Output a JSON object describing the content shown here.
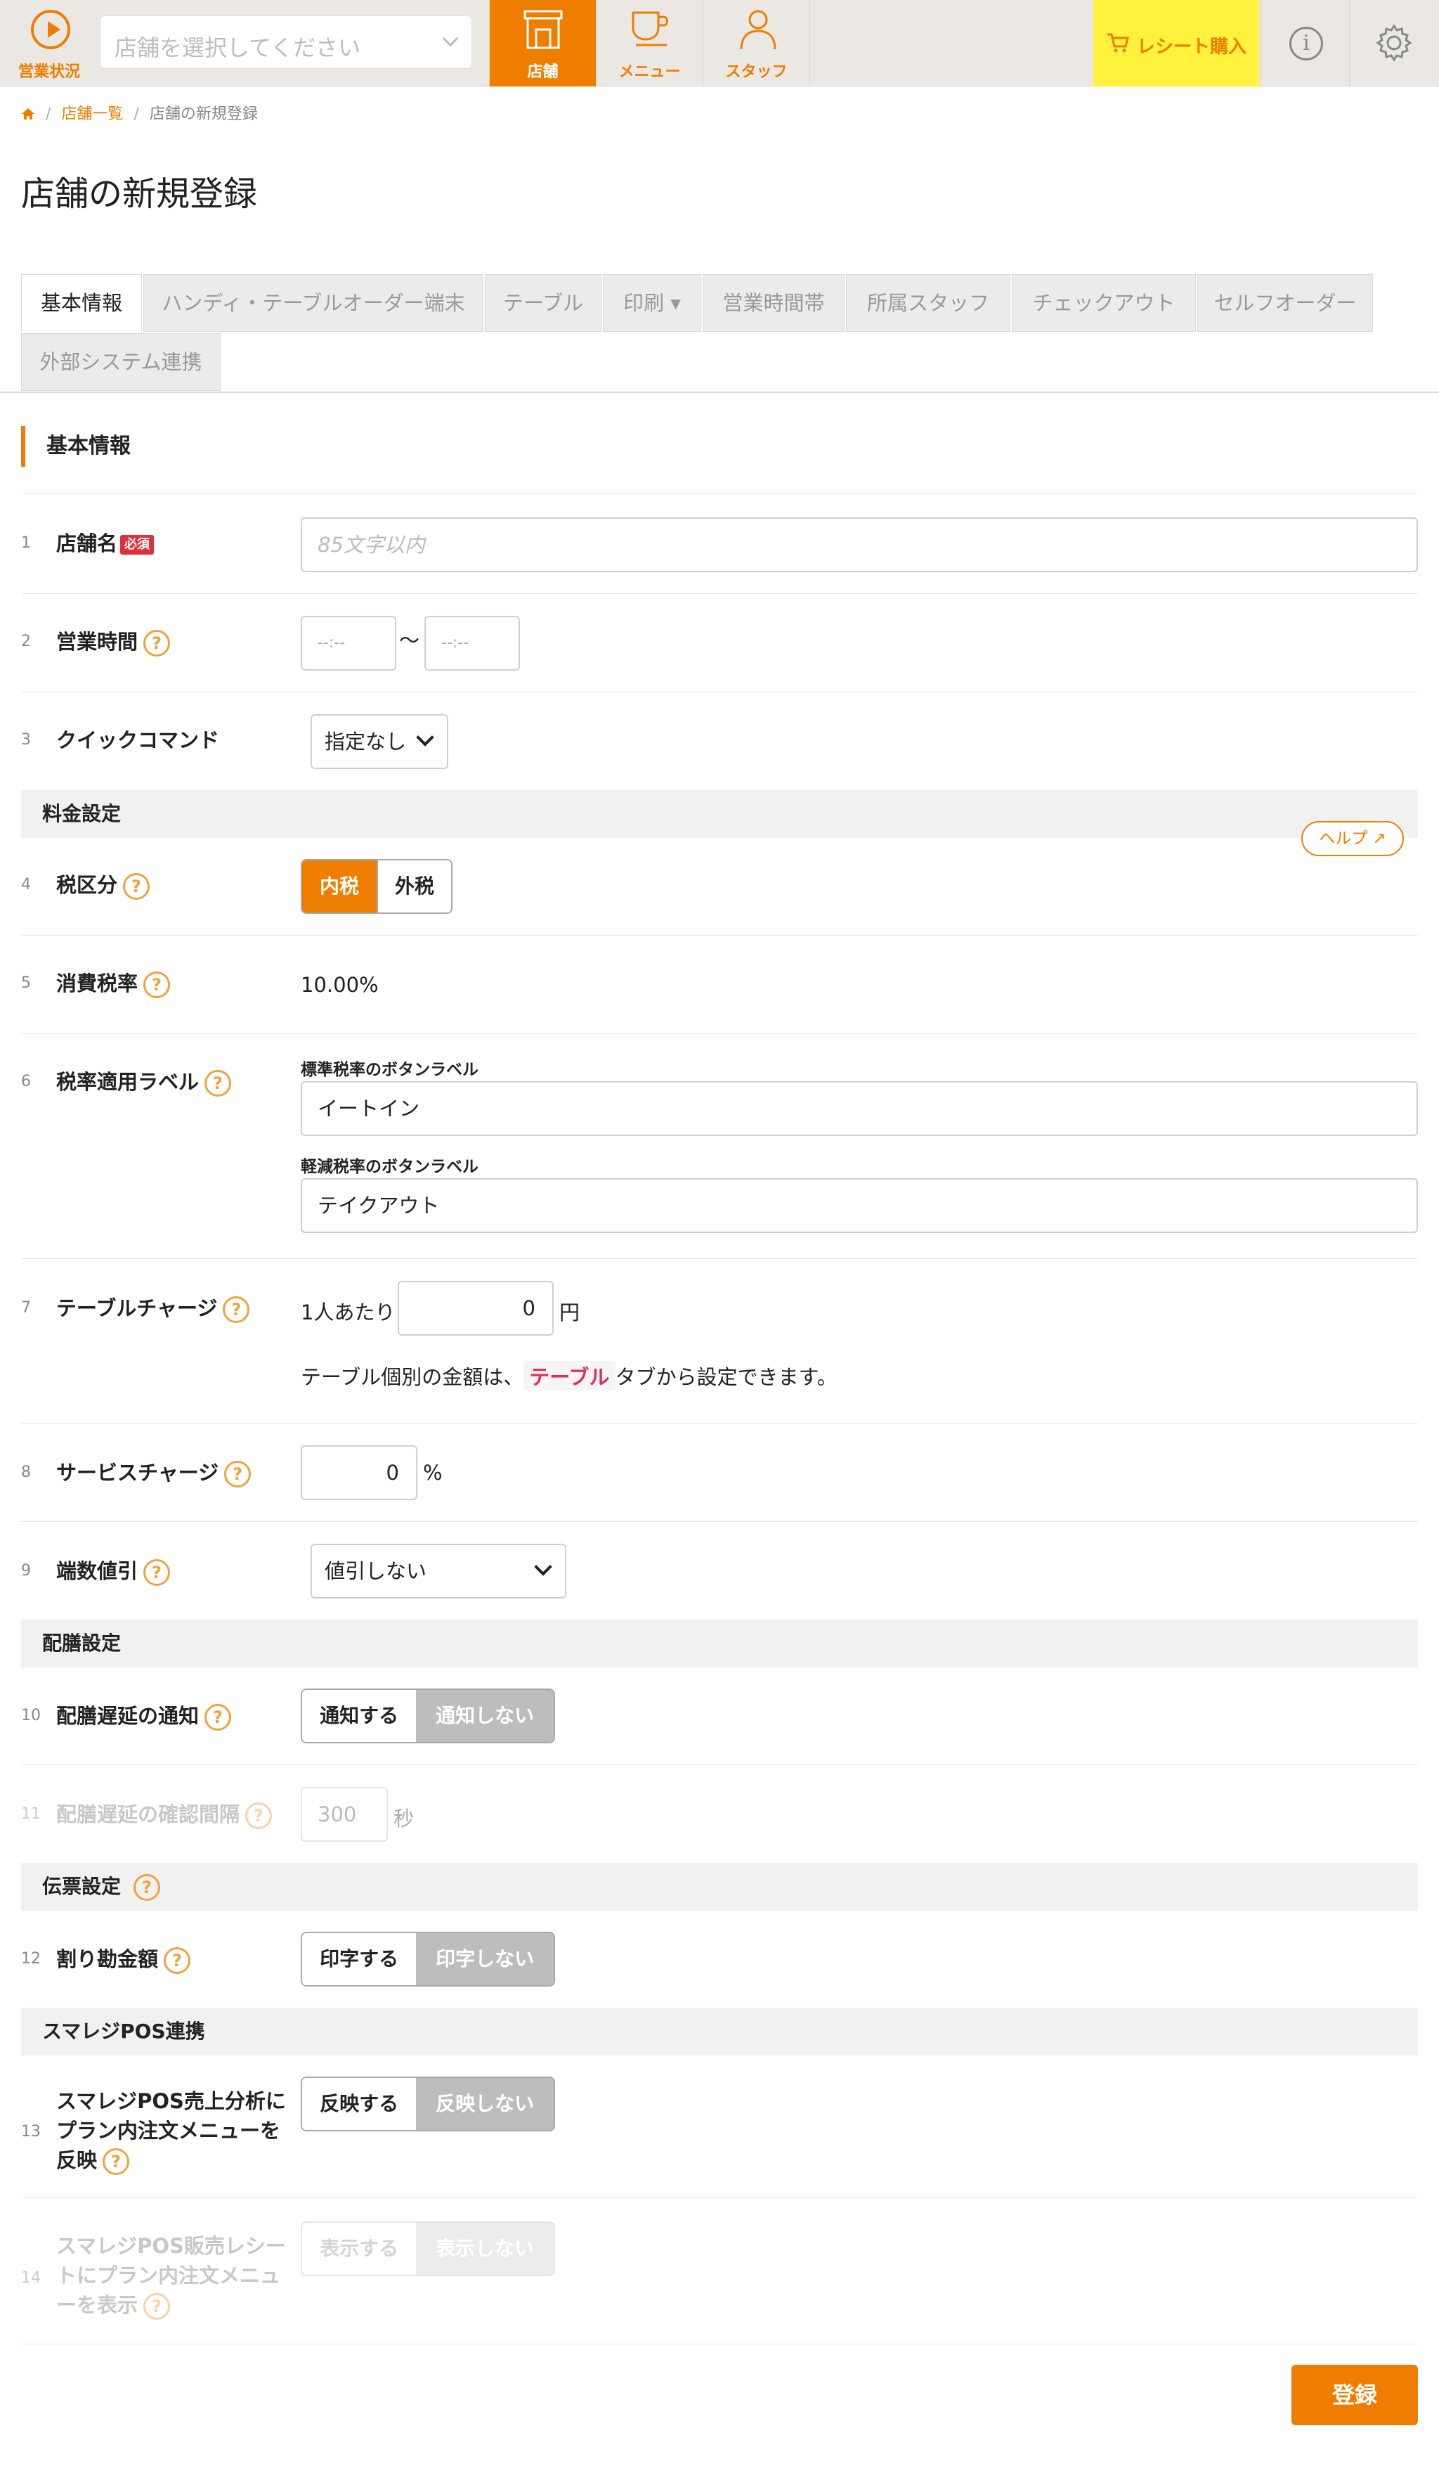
{
  "nav": {
    "status_label": "営業状況",
    "store_placeholder": "店舗を選択してください",
    "tabs": [
      {
        "label": "店舗"
      },
      {
        "label": "メニュー"
      },
      {
        "label": "スタッフ"
      }
    ],
    "receipt_label": "レシート購入",
    "info_icon": "i"
  },
  "breadcrumb": {
    "items": [
      "店舗一覧",
      "店舗の新規登録"
    ]
  },
  "page_title": "店舗の新規登録",
  "tabs": [
    "基本情報",
    "ハンディ・テーブルオーダー端末",
    "テーブル",
    "印刷 ▾",
    "営業時間帯",
    "所属スタッフ",
    "チェックアウト",
    "セルフオーダー",
    "外部システム連携"
  ],
  "section_title": "基本情報",
  "help_pill": "ヘルプ ↗",
  "rows": {
    "store_name": {
      "num": "1",
      "label": "店舗名",
      "required": "必須",
      "placeholder": "85文字以内"
    },
    "business_hours": {
      "num": "2",
      "label": "営業時間",
      "from": "--:--",
      "tilde": "〜",
      "to": "--:--"
    },
    "quick_command": {
      "num": "3",
      "label": "クイックコマンド",
      "value": "指定なし"
    },
    "price_section": "料金設定",
    "tax_type": {
      "num": "4",
      "label": "税区分",
      "options": [
        "内税",
        "外税"
      ]
    },
    "tax_rate": {
      "num": "5",
      "label": "消費税率",
      "value": "10.00%"
    },
    "tax_label": {
      "num": "6",
      "label": "税率適用ラベル",
      "std_title": "標準税率のボタンラベル",
      "std_value": "イートイン",
      "reduced_title": "軽減税率のボタンラベル",
      "reduced_value": "テイクアウト"
    },
    "table_charge": {
      "num": "7",
      "label": "テーブルチャージ",
      "prefix": "1人あたり",
      "value": "0",
      "unit": "円",
      "note_before": "テーブル個別の金額は、",
      "note_link": "テーブル",
      "note_after": "タブから設定できます。"
    },
    "service_charge": {
      "num": "8",
      "label": "サービスチャージ",
      "value": "0",
      "unit": "%"
    },
    "rounding": {
      "num": "9",
      "label": "端数値引",
      "value": "値引しない"
    },
    "serving_section": "配膳設定",
    "serving_delay": {
      "num": "10",
      "label": "配膳遅延の通知",
      "options": [
        "通知する",
        "通知しない"
      ]
    },
    "serving_interval": {
      "num": "11",
      "label": "配膳遅延の確認間隔",
      "value": "300",
      "unit": "秒"
    },
    "slip_section": "伝票設定",
    "split_amount": {
      "num": "12",
      "label": "割り勘金額",
      "options": [
        "印字する",
        "印字しない"
      ]
    },
    "pos_section": "スマレジPOS連携",
    "pos_analysis": {
      "num": "13",
      "label_lines": [
        "スマレジPOS売上分析に",
        "プラン内注文メニューを",
        "反映"
      ],
      "options": [
        "反映する",
        "反映しない"
      ]
    },
    "pos_receipt": {
      "num": "14",
      "label_lines": [
        "スマレジPOS販売レシー",
        "トにプラン内注文メニュ",
        "ーを表示"
      ],
      "options": [
        "表示する",
        "表示しない"
      ]
    }
  },
  "help_mark": "?",
  "register_label": "登録",
  "colors": {
    "accent": "#ee7d00",
    "receipt_bg": "#fff23c",
    "required": "#e0303a"
  }
}
